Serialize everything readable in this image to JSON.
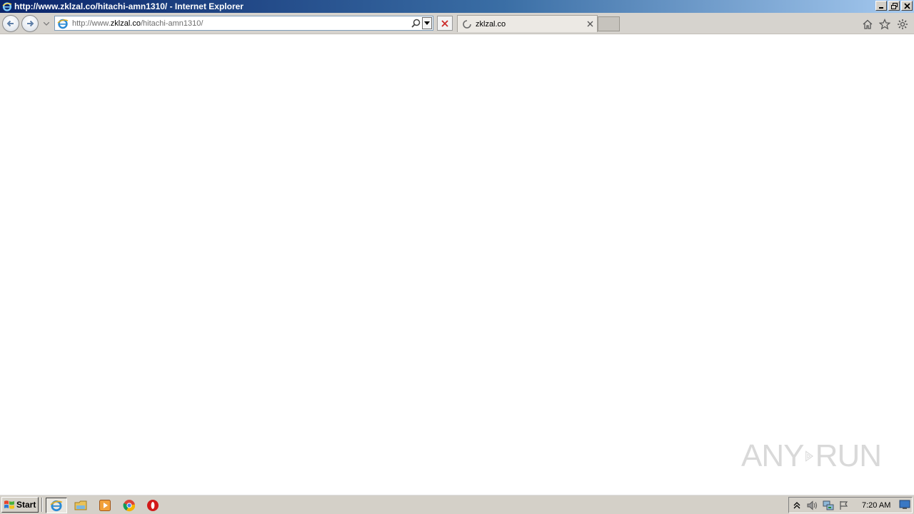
{
  "window": {
    "title": "http://www.zklzal.co/hitachi-amn1310/ - Internet Explorer"
  },
  "address_bar": {
    "url_prefix": "http://www.",
    "url_host": "zklzal.co",
    "url_path": "/hitachi-amn1310/"
  },
  "tabs": [
    {
      "label": "zklzal.co",
      "state": "loading"
    }
  ],
  "watermark": {
    "left": "ANY",
    "right": "RUN"
  },
  "taskbar": {
    "start_label": "Start",
    "clock": "7:20 AM",
    "pinned": [
      "ie-icon",
      "folder-icon",
      "media-player-icon",
      "chrome-icon",
      "opera-icon"
    ]
  },
  "colors": {
    "title_start": "#0a246a",
    "title_end": "#a6caf0",
    "chrome_gray": "#d4d0c8",
    "stop_red": "#cc2a2a"
  }
}
